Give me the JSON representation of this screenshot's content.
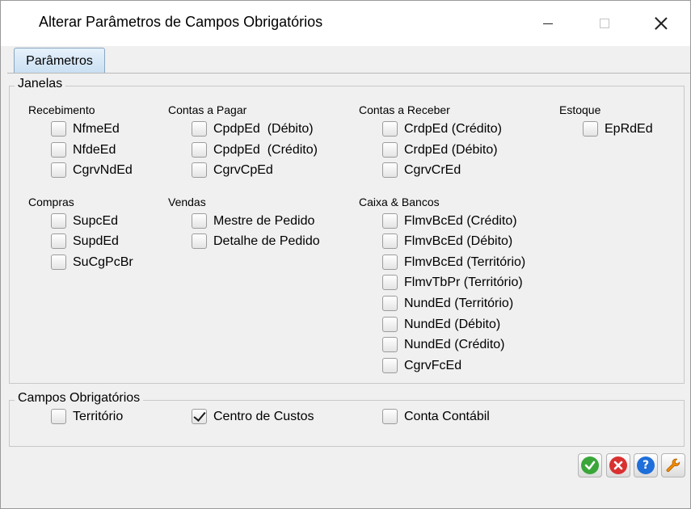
{
  "window": {
    "title": "Alterar Parâmetros de Campos Obrigatórios"
  },
  "tabs": [
    {
      "label": "Parâmetros"
    }
  ],
  "janelas": {
    "legend": "Janelas",
    "recebimento": {
      "title": "Recebimento",
      "items": [
        "NfmeEd",
        "NfdeEd",
        "CgrvNdEd"
      ]
    },
    "contas_pagar": {
      "title": "Contas a Pagar",
      "items": [
        "CpdpEd  (Débito)",
        "CpdpEd  (Crédito)",
        "CgrvCpEd"
      ]
    },
    "contas_receber": {
      "title": "Contas a Receber",
      "items": [
        "CrdpEd (Crédito)",
        "CrdpEd (Débito)",
        "CgrvCrEd"
      ]
    },
    "estoque": {
      "title": "Estoque",
      "items": [
        "EpRdEd"
      ]
    },
    "compras": {
      "title": "Compras",
      "items": [
        "SupcEd",
        "SupdEd",
        "SuCgPcBr"
      ]
    },
    "vendas": {
      "title": "Vendas",
      "items": [
        "Mestre de Pedido",
        "Detalhe de Pedido"
      ]
    },
    "caixa_bancos": {
      "title": "Caixa & Bancos",
      "items": [
        "FlmvBcEd (Crédito)",
        "FlmvBcEd (Débito)",
        "FlmvBcEd (Território)",
        "FlmvTbPr (Território)",
        "NundEd (Território)",
        "NundEd (Débito)",
        "NundEd (Crédito)",
        "CgrvFcEd"
      ]
    }
  },
  "campos": {
    "legend": "Campos Obrigatórios",
    "items": [
      {
        "label": "Território",
        "checked": false
      },
      {
        "label": "Centro de Custos",
        "checked": true
      },
      {
        "label": "Conta Contábil",
        "checked": false
      }
    ]
  },
  "actions": [
    {
      "icon": "confirm-icon",
      "color": "#3aa63a"
    },
    {
      "icon": "cancel-icon",
      "color": "#d93030"
    },
    {
      "icon": "help-icon",
      "color": "#1e6fd9"
    },
    {
      "icon": "wrench-icon",
      "color": "#f08a00"
    }
  ]
}
